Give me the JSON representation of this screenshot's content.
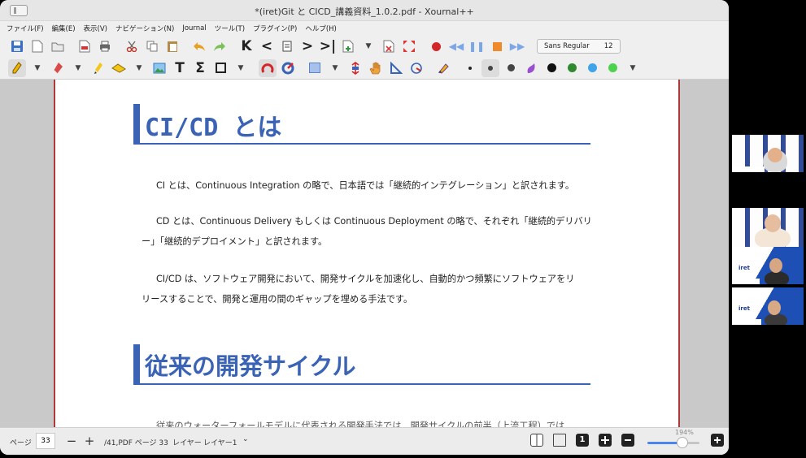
{
  "window": {
    "title": "*(iret)Git と CICD_講義資料_1.0.2.pdf - Xournal++"
  },
  "menubar": {
    "items": [
      "ファイル(F)",
      "編集(E)",
      "表示(V)",
      "ナビゲーション(N)",
      "Journal",
      "ツール(T)",
      "プラグイン(P)",
      "ヘルプ(H)"
    ]
  },
  "toolbar": {
    "font_name": "Sans Regular",
    "font_size": "12"
  },
  "document": {
    "heading1": "CI/CD とは",
    "para1": "CI とは、Continuous Integration の略で、日本語では「継続的インテグレーション」と訳されます。",
    "para2_line1": "CD とは、Continuous Delivery もしくは Continuous Deployment の略で、それぞれ「継続的デリバリ",
    "para2_line2": "ー」「継続的デプロイメント」と訳されます。",
    "para3_line1": "CI/CD は、ソフトウェア開発において、開発サイクルを加速化し、自動的かつ頻繁にソフトウェアをリ",
    "para3_line2": "リースすることで、開発と運用の間のギャップを埋める手法です。",
    "heading2": "従来の開発サイクル",
    "para4_partial": "従来のウォーターフォールモデルに代表される開発手法では、開発サイクルの前半（上流工程）では"
  },
  "statusbar": {
    "page_label": "ページ",
    "page_value": "33",
    "minus": "−",
    "plus": "+",
    "page_count": "/41,PDF ページ 33",
    "layer_label": "レイヤー",
    "layer_value": "レイヤー1",
    "layer_chevron": "⌄",
    "zoom_label": "194%"
  },
  "colors": {
    "heading_blue": "#3a63b5",
    "page_border_red": "#b03838",
    "record_red": "#d3262a"
  }
}
